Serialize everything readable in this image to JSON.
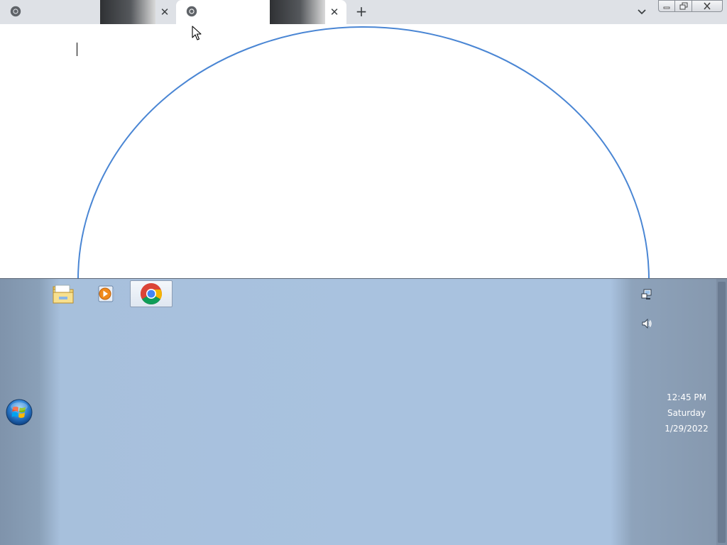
{
  "browser": {
    "tabs": [
      {
        "title": "",
        "active": false,
        "close_glyph": "✕",
        "favicon": "chrome-icon"
      },
      {
        "title": "",
        "active": true,
        "close_glyph": "✕",
        "favicon": "chrome-icon"
      }
    ],
    "new_tab_glyph": "+",
    "tab_search_icon": "chevron-down-icon",
    "window_controls": [
      "minimize-icon",
      "restore-icon",
      "close-icon"
    ]
  },
  "page": {
    "shape": "semicircle-outline",
    "stroke_color": "#4a86d4"
  },
  "taskbar": {
    "pinned": [
      {
        "name": "windows-explorer",
        "icon": "folder-icon",
        "active": false
      },
      {
        "name": "windows-media-player",
        "icon": "media-player-icon",
        "active": false
      },
      {
        "name": "google-chrome",
        "icon": "chrome-icon",
        "active": true
      }
    ],
    "tray": {
      "network_icon": "network-icon",
      "volume_icon": "speaker-icon"
    },
    "clock": {
      "time": "12:45 PM",
      "day": "Saturday",
      "date": "1/29/2022"
    },
    "colors": {
      "background": "#a9c2df",
      "text": "#ffffff"
    }
  }
}
